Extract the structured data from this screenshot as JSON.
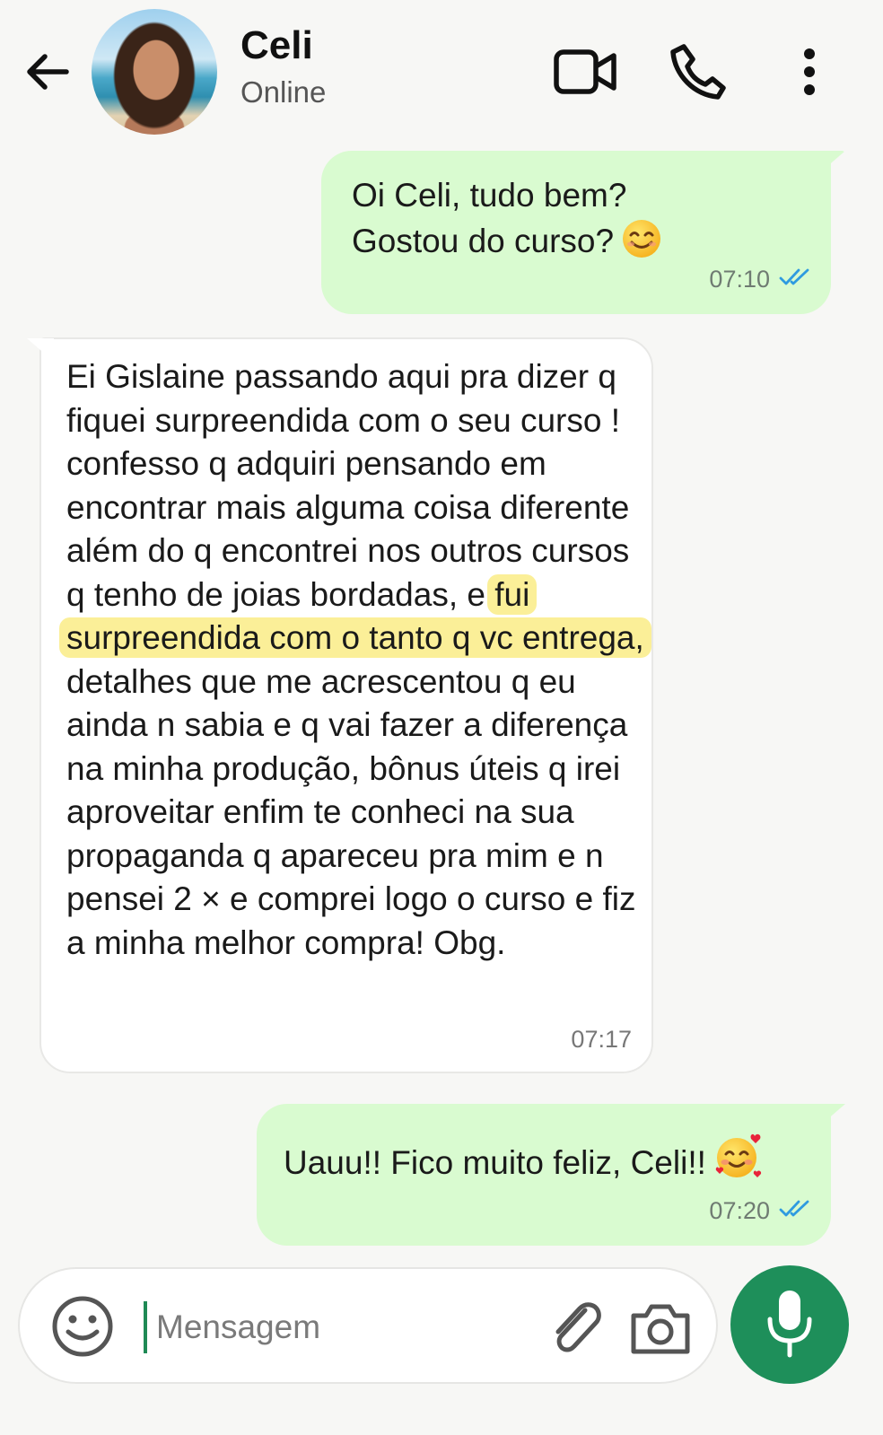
{
  "header": {
    "contact_name": "Celi",
    "status": "Online",
    "icons": [
      "back-arrow-icon",
      "video-call-icon",
      "phone-icon",
      "more-vertical-icon"
    ]
  },
  "messages": [
    {
      "direction": "outgoing",
      "lines": [
        "Oi Celi, tudo bem?",
        "Gostou do curso?"
      ],
      "emoji": "smiling-face-icon",
      "time": "07:10",
      "read": true
    },
    {
      "direction": "incoming",
      "text_before": "Ei Gislaine passando aqui pra dizer q fiquei surpreendida com o seu curso ! confesso q adquiri pensando em encontrar mais alguma coisa diferente além do q encontrei nos outros cursos q tenho de joias bordadas, e",
      "highlighted": "fui surpreendida com o tanto q vc entrega,",
      "text_after": "detalhes que me acrescentou q eu ainda n sabia e q vai fazer a diferença na minha produção, bônus úteis q irei aproveitar enfim te conheci na sua propaganda q apareceu pra mim e n pensei 2 × e comprei logo o curso e fiz a minha melhor compra! Obg.",
      "time": "07:17"
    },
    {
      "direction": "outgoing",
      "text": "Uauu!! Fico muito feliz, Celi!!",
      "emoji": "smiling-face-with-hearts-icon",
      "time": "07:20",
      "read": true
    }
  ],
  "composer": {
    "placeholder": "Mensagem"
  },
  "colors": {
    "outgoing_bubble": "#d9fbd0",
    "incoming_bubble": "#ffffff",
    "highlight": "#fbef98",
    "read_ticks": "#2f9be0",
    "mic_button": "#1e8f5a"
  }
}
